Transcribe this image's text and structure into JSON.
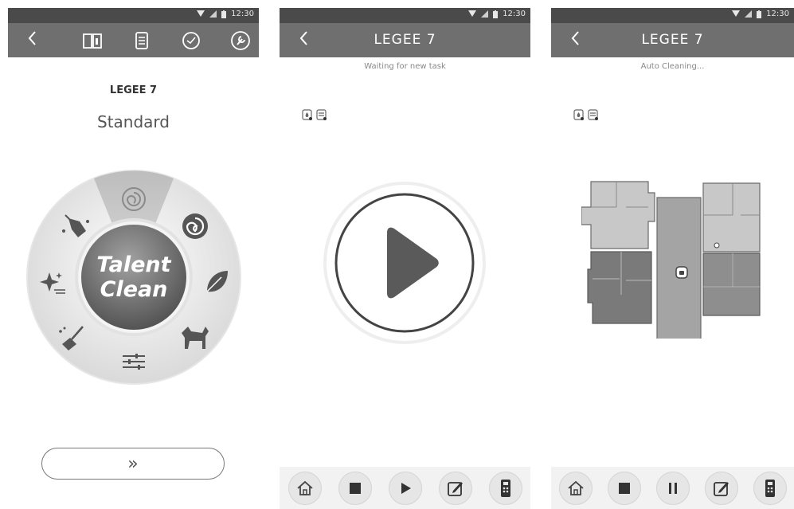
{
  "status_time": "12:30",
  "screen1": {
    "device_name": "LEGEE 7",
    "mode": "Standard",
    "center_line1": "Talent",
    "center_line2": "Clean",
    "next_label": "»",
    "icons": [
      "back-icon",
      "manual-book-icon",
      "document-icon",
      "clock-icon",
      "wrench-icon"
    ]
  },
  "screen2": {
    "title": "LEGEE 7",
    "status": "Waiting for new task",
    "bottom_icons": [
      "home-icon",
      "stop-icon",
      "play-icon",
      "edit-icon",
      "remote-icon"
    ]
  },
  "screen3": {
    "title": "LEGEE 7",
    "status": "Auto Cleaning...",
    "bottom_icons": [
      "home-icon",
      "stop-icon",
      "pause-icon",
      "edit-icon",
      "remote-icon"
    ]
  },
  "colors": {
    "status_bar": "#4a4a4a",
    "top_bar": "#6f6f6f",
    "accent_dark": "#5a5a5a"
  }
}
